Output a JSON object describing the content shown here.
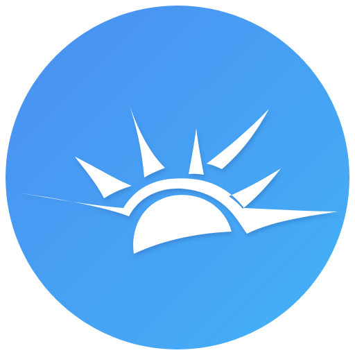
{
  "icon": {
    "name": "sunrise-icon",
    "colors": {
      "gradient_start": "#4a8ff0",
      "gradient_end": "#44b2f7",
      "symbol": "#ffffff",
      "shadow": "#2f6fb8"
    }
  }
}
